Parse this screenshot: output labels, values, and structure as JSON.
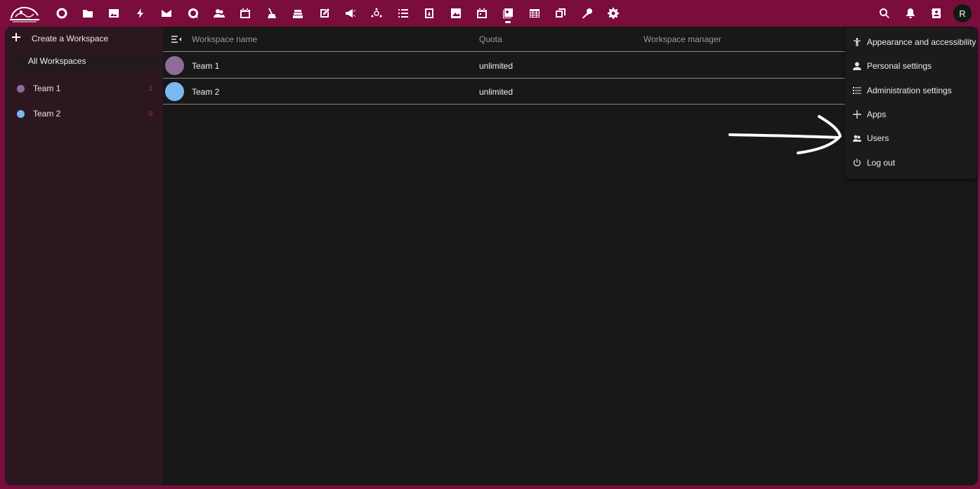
{
  "topbar": {
    "apps": [
      {
        "icon": "dashboard-icon"
      },
      {
        "icon": "files-icon"
      },
      {
        "icon": "photos-icon"
      },
      {
        "icon": "activity-icon"
      },
      {
        "icon": "mail-icon"
      },
      {
        "icon": "talk-icon"
      },
      {
        "icon": "contacts-icon"
      },
      {
        "icon": "calendar-icon"
      },
      {
        "icon": "cleanup-icon"
      },
      {
        "icon": "deck-icon"
      },
      {
        "icon": "notes-icon"
      },
      {
        "icon": "announcements-icon"
      },
      {
        "icon": "circles-icon"
      },
      {
        "icon": "tasks-icon"
      },
      {
        "icon": "forms-icon"
      },
      {
        "icon": "gallery-icon"
      },
      {
        "icon": "appointments-icon"
      },
      {
        "icon": "workspaces-icon",
        "active": true
      },
      {
        "icon": "tables-icon"
      },
      {
        "icon": "whiteboard-icon"
      },
      {
        "icon": "passwords-icon"
      },
      {
        "icon": "settings-icon"
      }
    ],
    "avatar_letter": "R"
  },
  "sidebar": {
    "create_label": "Create a Workspace",
    "all_label": "All Workspaces",
    "items": [
      {
        "label": "Team 1",
        "count": "2",
        "color": "#8e6b9a"
      },
      {
        "label": "Team 2",
        "count": "0",
        "color": "#7ab8f0"
      }
    ]
  },
  "table": {
    "headers": {
      "name": "Workspace name",
      "quota": "Quota",
      "manager": "Workspace manager"
    },
    "rows": [
      {
        "name": "Team 1",
        "quota": "unlimited",
        "color": "#8e6b9a"
      },
      {
        "name": "Team 2",
        "quota": "unlimited",
        "color": "#7ab8f0"
      }
    ]
  },
  "menu": {
    "items": [
      {
        "label": "Appearance and accessibility",
        "icon": "accessibility-icon"
      },
      {
        "label": "Personal settings",
        "icon": "person-icon"
      },
      {
        "label": "Administration settings",
        "icon": "admin-list-icon"
      },
      {
        "label": "Apps",
        "icon": "plus-icon"
      },
      {
        "label": "Users",
        "icon": "users-icon"
      },
      {
        "label": "Log out",
        "icon": "power-icon"
      }
    ]
  },
  "colors": {
    "brand": "#7a0d3b",
    "background": "#181818",
    "sidebar": "#2c1720"
  }
}
